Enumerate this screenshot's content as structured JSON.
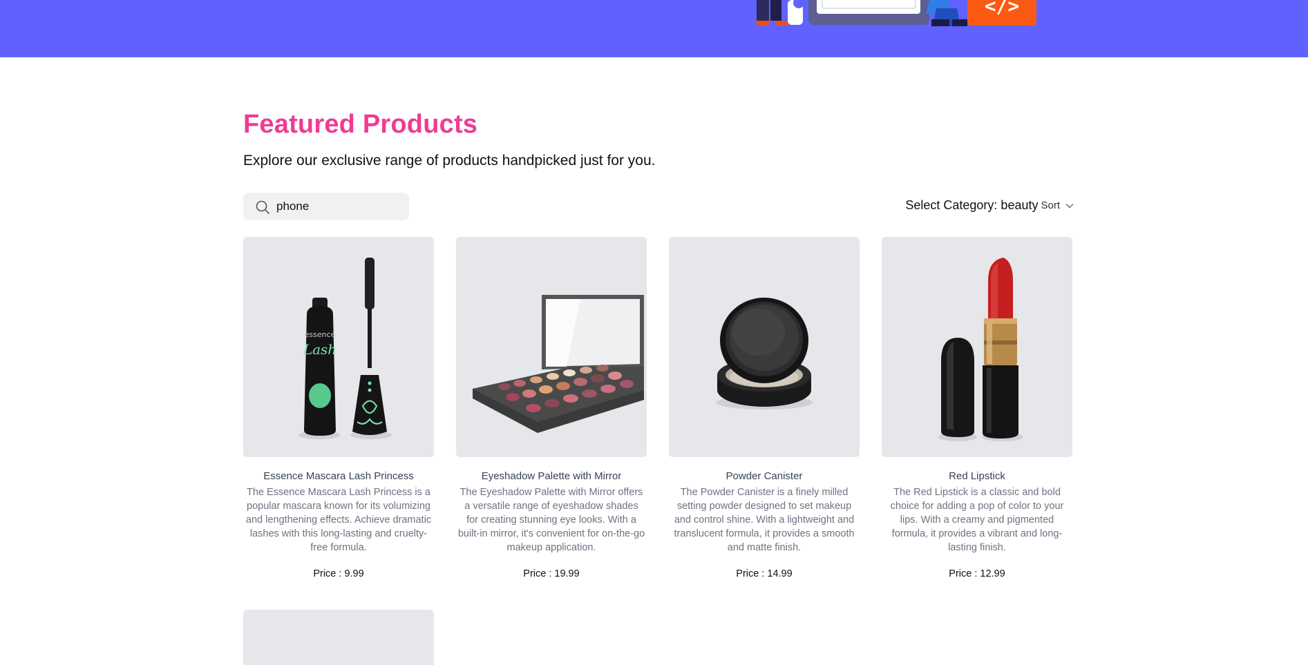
{
  "hero": {
    "illustration_icon": "developer-illustration",
    "code_glyph": "</>"
  },
  "featured": {
    "title": "Featured Products",
    "subtitle": "Explore our exclusive range of products handpicked just for you."
  },
  "search": {
    "value": "phone",
    "icon": "search-icon"
  },
  "category": {
    "label": "Select Category: beauty",
    "sort": "Sort"
  },
  "products": [
    {
      "name": "Essence Mascara Lash Princess",
      "description": "The Essence Mascara Lash Princess is a popular mascara known for its volumizing and lengthening effects. Achieve dramatic lashes with this long-lasting and cruelty-free formula.",
      "price": "Price : 9.99",
      "image_icon": "mascara-image",
      "image_text": "essence Lash Princess"
    },
    {
      "name": "Eyeshadow Palette with Mirror",
      "description": "The Eyeshadow Palette with Mirror offers a versatile range of eyeshadow shades for creating stunning eye looks. With a built-in mirror, it's convenient for on-the-go makeup application.",
      "price": "Price : 19.99",
      "image_icon": "eyeshadow-palette-image"
    },
    {
      "name": "Powder Canister",
      "description": "The Powder Canister is a finely milled setting powder designed to set makeup and control shine. With a lightweight and translucent formula, it provides a smooth and matte finish.",
      "price": "Price : 14.99",
      "image_icon": "powder-canister-image"
    },
    {
      "name": "Red Lipstick",
      "description": "The Red Lipstick is a classic and bold choice for adding a pop of color to your lips. With a creamy and pigmented formula, it provides a vibrant and long-lasting finish.",
      "price": "Price : 12.99",
      "image_icon": "lipstick-image"
    }
  ],
  "colors": {
    "hero_bg": "#6161ff",
    "title": "#ee3b94",
    "card_bg": "#e6e7ea",
    "search_bg": "#f2f1f0",
    "accent_orange": "#fa5a14"
  }
}
